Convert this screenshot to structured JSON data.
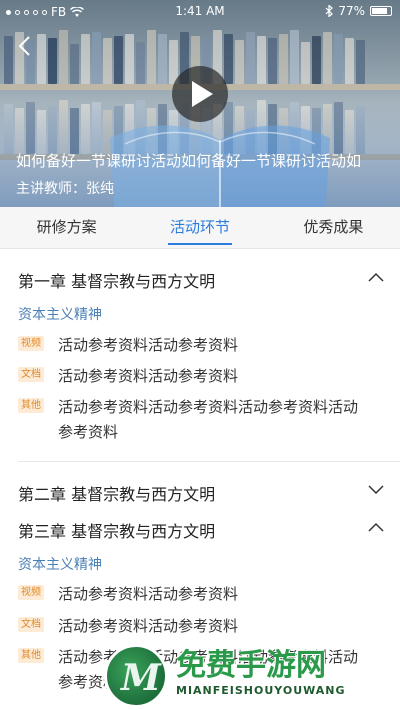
{
  "status_bar": {
    "carrier": "FB",
    "time": "1:41 AM",
    "battery": "77%"
  },
  "video": {
    "title": "如何备好一节课研讨活动如何备好一节课研讨活动如",
    "teacher": "主讲教师：张纯"
  },
  "tabs": [
    {
      "label": "研修方案"
    },
    {
      "label": "活动环节",
      "active": true
    },
    {
      "label": "优秀成果"
    }
  ],
  "chapters": [
    {
      "title": "第一章  基督宗教与西方文明",
      "expanded": true,
      "section": "资本主义精神",
      "items": [
        {
          "tag": "视频",
          "text": "活动参考资料活动参考资料"
        },
        {
          "tag": "文档",
          "text": "活动参考资料活动参考资料"
        },
        {
          "tag": "其他",
          "text": "活动参考资料活动参考资料活动参考资料活动参考资料"
        }
      ]
    },
    {
      "title": "第二章  基督宗教与西方文明",
      "expanded": false
    },
    {
      "title": "第三章  基督宗教与西方文明",
      "expanded": true,
      "section": "资本主义精神",
      "items": [
        {
          "tag": "视频",
          "text": "活动参考资料活动参考资料"
        },
        {
          "tag": "文档",
          "text": "活动参考资料活动参考资料"
        },
        {
          "tag": "其他",
          "text": "活动参考资料活动参考资料活动参考资料活动参考资料"
        }
      ]
    }
  ],
  "watermark": {
    "chinese": "免费手游网",
    "english": "MIANFEISHOUYOUWANG"
  },
  "colors": {
    "accent": "#2a7ddd",
    "section": "#4a7fb5",
    "tag_text": "#e08a2a",
    "tag_bg": "#fdebd5"
  },
  "icons": [
    "back-arrow-icon",
    "play-icon",
    "wifi-icon",
    "bluetooth-icon",
    "battery-icon",
    "chevron-up-icon",
    "chevron-down-icon"
  ]
}
